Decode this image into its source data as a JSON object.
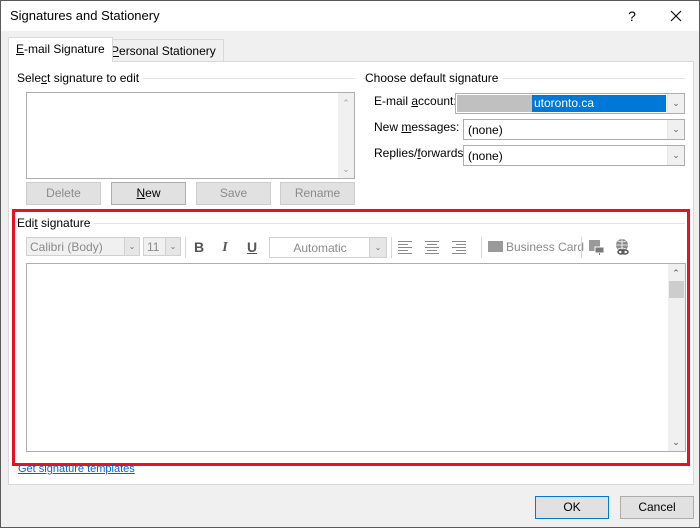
{
  "window": {
    "title": "Signatures and Stationery",
    "help_label": "?",
    "close_icon": "close-icon"
  },
  "tabs": [
    {
      "label_pre": "",
      "accel": "E",
      "label_post": "-mail Signature",
      "active": true
    },
    {
      "label_pre": "",
      "accel": "P",
      "label_post": "ersonal Stationery",
      "active": false
    }
  ],
  "select_signature": {
    "label_pre": "Sele",
    "accel": "c",
    "label_post": "t signature to edit",
    "items": [],
    "buttons": {
      "delete": "Delete",
      "new_accel": "N",
      "new_rest": "ew",
      "save": "Save",
      "rename": "Rename"
    }
  },
  "default_signature": {
    "label": "Choose default signature",
    "email_account": {
      "label_pre": "E-mail ",
      "accel": "a",
      "label_post": "ccount:",
      "value": "utoronto.ca"
    },
    "new_messages": {
      "label_pre": "New ",
      "accel": "m",
      "label_post": "essages:",
      "value": "(none)"
    },
    "replies_forwards": {
      "label_pre": "Replies/",
      "accel": "f",
      "label_post": "orwards:",
      "value": "(none)"
    }
  },
  "edit_signature": {
    "label_pre": "Edi",
    "accel": "t",
    "label_post": " signature",
    "font": "Calibri (Body)",
    "size": "11",
    "bold": "B",
    "italic": "I",
    "underline": "U",
    "color": "Automatic",
    "business_card": "Business Card",
    "content": "",
    "highlight_color": "#e81123"
  },
  "footer": {
    "templates_link": "Get signature templates",
    "ok": "OK",
    "cancel": "Cancel"
  }
}
